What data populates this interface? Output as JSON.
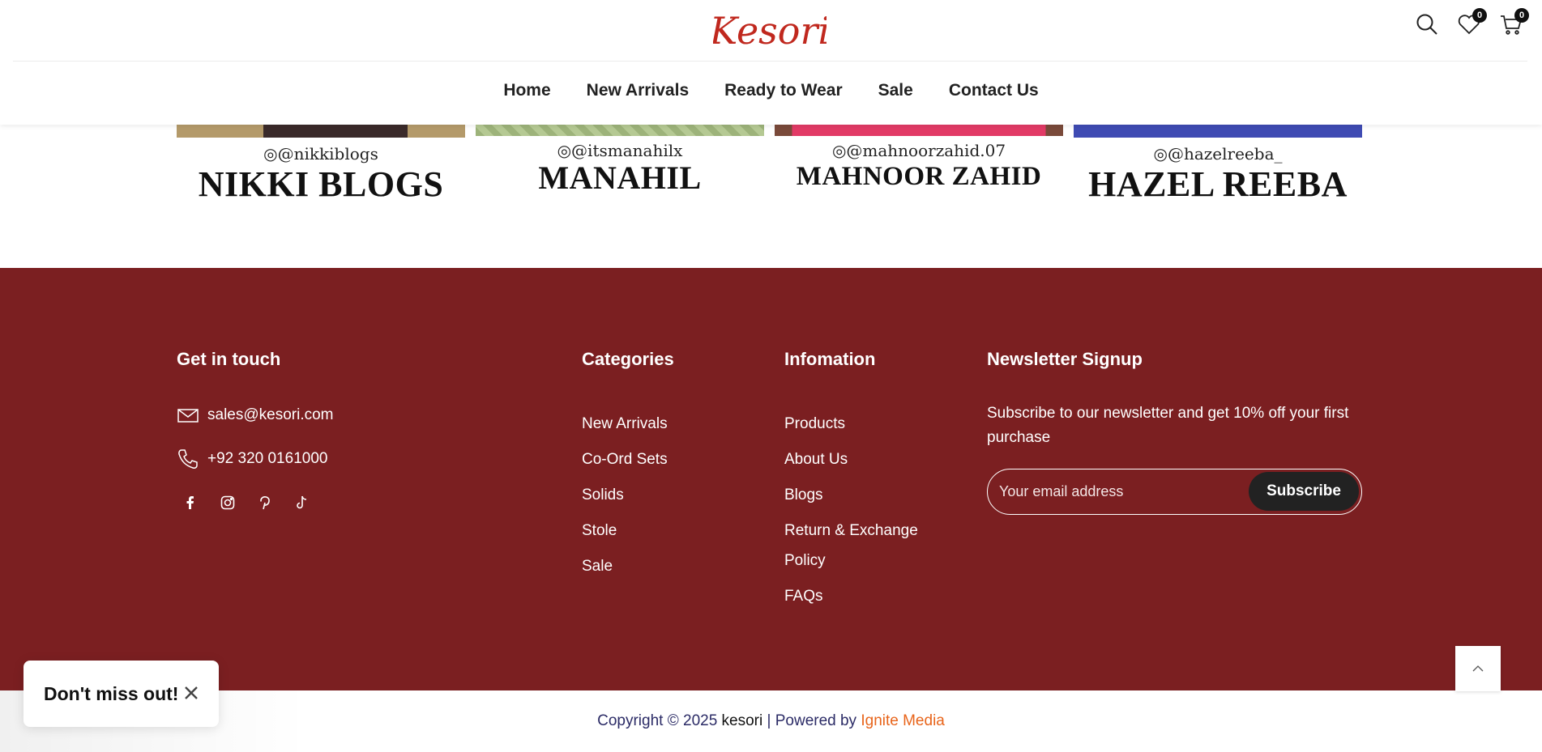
{
  "header": {
    "logo_text": "Kesori",
    "wishlist_count": "0",
    "cart_count": "0",
    "nav": [
      "Home",
      "New Arrivals",
      "Ready to Wear",
      "Sale",
      "Contact Us"
    ]
  },
  "influencers": [
    {
      "handle": "@nikkiblogs",
      "name": "NIKKI BLOGS"
    },
    {
      "handle": "@itsmanahilx",
      "name": "MANAHIL"
    },
    {
      "handle": "@mahnoorzahid.07",
      "name": "MAHNOOR ZAHID"
    },
    {
      "handle": "@hazelreeba_",
      "name": "HAZEL REEBA"
    }
  ],
  "footer": {
    "get_in_touch": {
      "title": "Get in touch",
      "email": "sales@kesori.com",
      "phone": "+92 320 0161000"
    },
    "categories": {
      "title": "Categories",
      "items": [
        "New Arrivals",
        "Co-Ord Sets",
        "Solids",
        "Stole",
        "Sale"
      ]
    },
    "information": {
      "title": "Infomation",
      "items": [
        "Products",
        "About Us",
        "Blogs",
        "Return & Exchange Policy",
        "FAQs"
      ]
    },
    "newsletter": {
      "title": "Newsletter Signup",
      "text": "Subscribe to our newsletter and get 10% off your first purchase",
      "placeholder": "Your email address",
      "button": "Subscribe"
    }
  },
  "copyright": {
    "prefix": "Copyright © 2025 ",
    "brand": "kesori",
    "separator": " | Powered by ",
    "powered": "Ignite Media"
  },
  "popup": {
    "text": "Don't miss out!"
  },
  "colors": {
    "footer_bg": "#7b1f21",
    "logo": "#c0281e",
    "powered_link": "#e8641a"
  }
}
